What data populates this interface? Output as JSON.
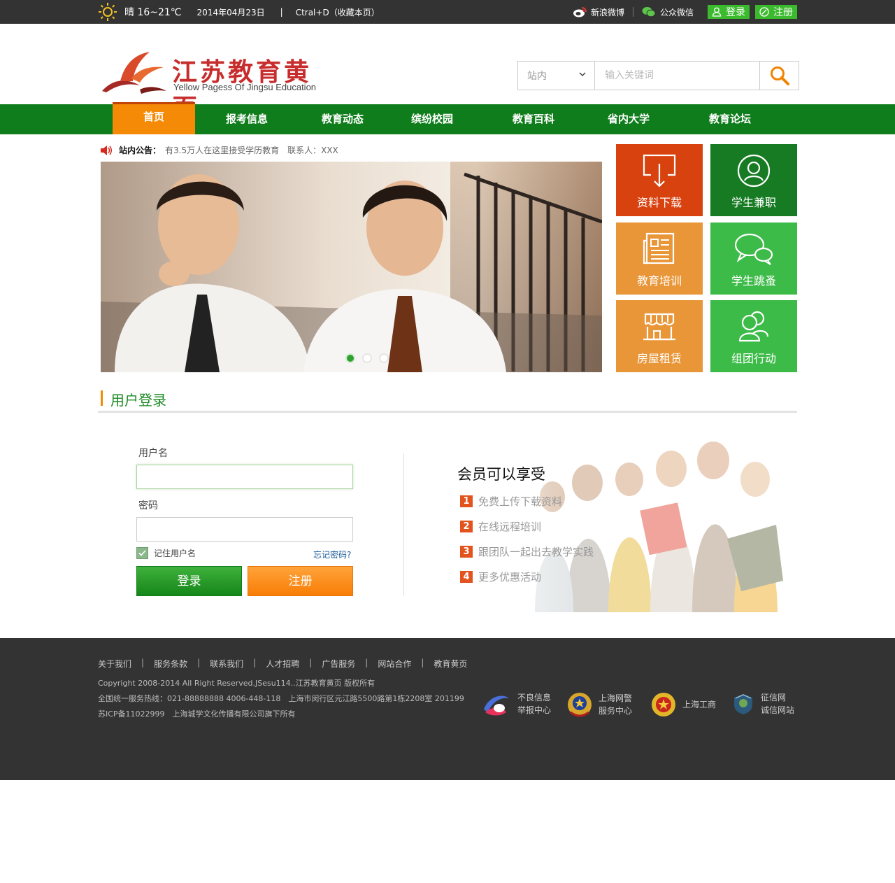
{
  "topbar": {
    "weather": "晴 16~21℃",
    "date": "2014年04月23日",
    "separator": "|",
    "bookmark": "Ctral+D（收藏本页）",
    "weibo": "新浪微博",
    "wechat": "公众微信",
    "login": "登录",
    "register": "注册"
  },
  "header": {
    "logo_title": "江苏教育黄页",
    "logo_subtitle": "Yellow Pagess Of Jingsu Education",
    "search_scope": "站内",
    "search_placeholder": "输入关键词"
  },
  "nav": {
    "items": [
      "首页",
      "报考信息",
      "教育动态",
      "缤纷校园",
      "教育百科",
      "省内大学",
      "教育论坛"
    ]
  },
  "notice": {
    "label": "站内公告：",
    "text": "有3.5万人在这里接受学历教育　联系人：XXX"
  },
  "tiles": [
    {
      "label": "资料下载",
      "color": "#d8420f",
      "icon": "download-icon"
    },
    {
      "label": "学生兼职",
      "color": "#167b22",
      "icon": "user-icon"
    },
    {
      "label": "教育培训",
      "color": "#e99638",
      "icon": "newspaper-icon"
    },
    {
      "label": "学生跳蚤",
      "color": "#3dbb48",
      "icon": "chat-icon"
    },
    {
      "label": "房屋租赁",
      "color": "#e99638",
      "icon": "shop-icon"
    },
    {
      "label": "组团行动",
      "color": "#3dbb48",
      "icon": "group-icon"
    }
  ],
  "login": {
    "section_title": "用户登录",
    "username_label": "用户名",
    "password_label": "密码",
    "remember": "记住用户名",
    "forgot": "忘记密码?",
    "login_button": "登录",
    "register_button": "注册"
  },
  "perks": {
    "title": "会员可以享受",
    "items": [
      {
        "num": "1",
        "text": "免费上传下载资料"
      },
      {
        "num": "2",
        "text": "在线远程培训"
      },
      {
        "num": "3",
        "text": "跟团队一起出去教学实践"
      },
      {
        "num": "4",
        "text": "更多优惠活动"
      }
    ]
  },
  "footer": {
    "links": [
      "关于我们",
      "服务条款",
      "联系我们",
      "人才招聘",
      "广告服务",
      "网站合作",
      "教育黄页"
    ],
    "copyright": "Copyright 2008-2014 All Right Reserved.JSesu114..江苏教育黄页 版权所有",
    "hotline": "全国统一服务热线：021-88888888 4006-448-118　上海市闵行区元江路5500路第1栋2208室 201199",
    "icp": "苏ICP备11022999　上海城学文化传播有限公司旗下所有",
    "badges": [
      {
        "line1": "不良信息",
        "line2": "举报中心"
      },
      {
        "line1": "上海网警",
        "line2": "服务中心"
      },
      {
        "line1": "上海工商",
        "line2": ""
      },
      {
        "line1": "征信网",
        "line2": "诚信网站"
      }
    ]
  },
  "colors": {
    "nav_green": "#107d1c",
    "accent_orange": "#f58a07",
    "topbar": "#333333"
  }
}
